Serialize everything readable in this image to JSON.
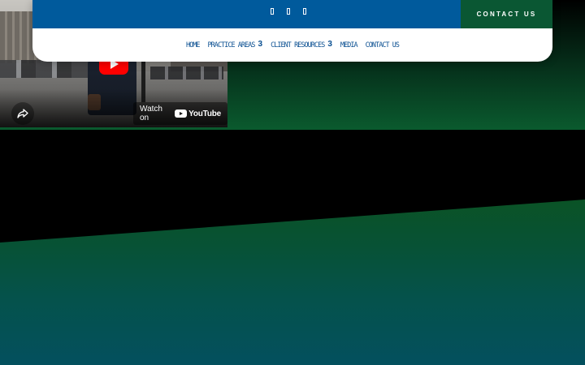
{
  "video": {
    "watch_on_label": "Watch on",
    "platform_name": "YouTube",
    "icons": {
      "play": "play-icon",
      "share": "share-icon",
      "logo": "youtube-logo"
    }
  },
  "header": {
    "social_icons": [
      "social-icon-1",
      "social-icon-2",
      "social-icon-3"
    ],
    "contact_button_label": "CONTACT US",
    "nav": [
      {
        "label": "HOME",
        "chevron": ""
      },
      {
        "label": "PRACTICE AREAS",
        "chevron": "3"
      },
      {
        "label": "CLIENT RESOURCES",
        "chevron": "3"
      },
      {
        "label": "MEDIA",
        "chevron": ""
      },
      {
        "label": "CONTACT US",
        "chevron": ""
      }
    ]
  },
  "colors": {
    "header_blue": "#005a9c",
    "contact_green": "#0a5733",
    "nav_text": "#0a4f91",
    "youtube_red": "#ff0000"
  }
}
